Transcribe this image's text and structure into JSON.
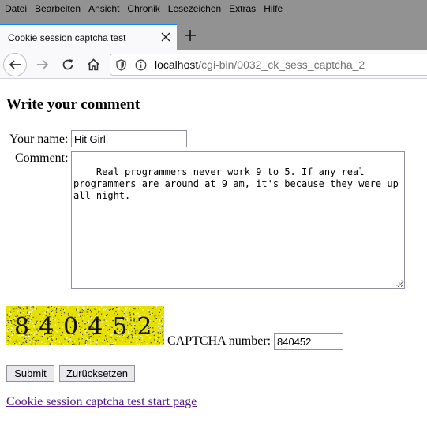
{
  "menubar": {
    "items": [
      "Datei",
      "Bearbeiten",
      "Ansicht",
      "Chronik",
      "Lesezeichen",
      "Extras",
      "Hilfe"
    ]
  },
  "tab": {
    "title": "Cookie session captcha test",
    "close_icon": "close-icon",
    "new_tab_icon": "plus-icon"
  },
  "navbar": {
    "url_host": "localhost",
    "url_path": "/cgi-bin/0032_ck_sess_captcha_2",
    "icons": [
      "back-arrow-icon",
      "forward-arrow-icon",
      "reload-icon",
      "home-icon",
      "shield-icon",
      "info-icon"
    ]
  },
  "page": {
    "heading": "Write your comment",
    "name_label": "Your name:",
    "name_value": "Hit Girl",
    "comment_label": "Comment:",
    "comment_value": "Real programmers never work 9 to 5. If any real programmers are around at 9 am, it's because they were up all night.",
    "captcha_image_text": "840452",
    "captcha_label": "CAPTCHA number:",
    "captcha_value": "840452",
    "submit_label": "Submit",
    "reset_label": "Zurücksetzen",
    "start_link": "Cookie session captcha test start page"
  },
  "colors": {
    "chrome_dark": "#929292",
    "tab_accent": "#0a84ff",
    "link_visited": "#551a8b",
    "captcha_noise": "#d8d300"
  }
}
